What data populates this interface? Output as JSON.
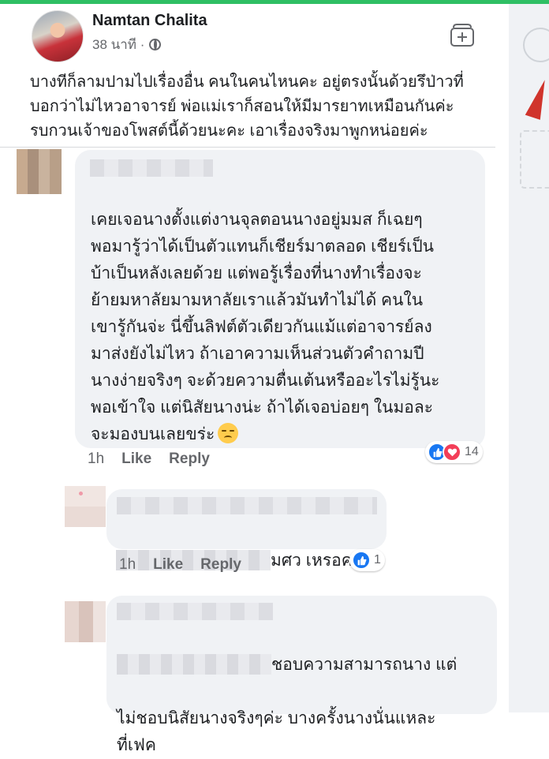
{
  "post": {
    "author": "Namtan Chalita",
    "time": "38 นาที ·",
    "text": "บางทีก็ลามปามไปเรื่องอื่น คนในคนไหนคะ อยู่ตรงนั้นด้วยรึป่าวที่\nบอกว่าไม่ไหวอาจารย์ พ่อแม่เราก็สอนให้มีมารยาทเหมือนกันค่ะ\nรบกวนเจ้าของโพสต์นี้ด้วยนะคะ เอาเรื่องจริงมาพูกหน่อยค่ะ"
  },
  "comments": [
    {
      "text": "เคยเจอนางตั้งแต่งานจุลตอนนางอยู่มมส ก็เฉยๆ\nพอมารู้ว่าได้เป็นตัวแทนก็เชียร์มาตลอด เชียร์เป็น\nบ้าเป็นหลังเลยด้วย แต่พอรู้เรื่องที่นางทำเรื่องจะ\nย้ายมหาลัยมามหาลัยเราแล้วมันทำไม่ได้ คนใน\nเขารู้กันจ่ะ นี่ขึ้นลิฟต์ตัวเดียวกันแม้แต่อาจารย์ลง\nมาส่งยังไม่ไหว ถ้าเอาความเห็นส่วนตัวคำถามปี\nนางง่ายจริงๆ จะด้วยความตื่นเต้นหรืออะไรไม่รู้นะ\nพอเข้าใจ แต่นิสัยนางน่ะ ถ้าได้เจอบ่อยๆ ในมอละ",
      "last_line": "จะมองบนเลยขร่ะ",
      "time": "1h",
      "like": "Like",
      "reply": "Reply",
      "reaction_count": "14"
    },
    {
      "text_visible": "มศว เหรอคะ",
      "time": "1h",
      "like": "Like",
      "reply": "Reply",
      "reaction_count": "1"
    },
    {
      "line1_visible": "ชอบความสามารถนาง แต่",
      "rest": "ไม่ชอบนิสัยนางจริงๆค่ะ บางครั้งนางนั่นแหละ\nที่เฟค"
    }
  ],
  "icons": {
    "globe": "globe-icon",
    "save": "save-post-icon",
    "like_reaction": "like-reaction-icon",
    "love_reaction": "love-reaction-icon",
    "emoji": "unamused-face-icon"
  },
  "colors": {
    "accent_green": "#2fbf64",
    "like_blue": "#1877f2",
    "love_red": "#f33e58",
    "bubble": "#f0f2f5"
  }
}
